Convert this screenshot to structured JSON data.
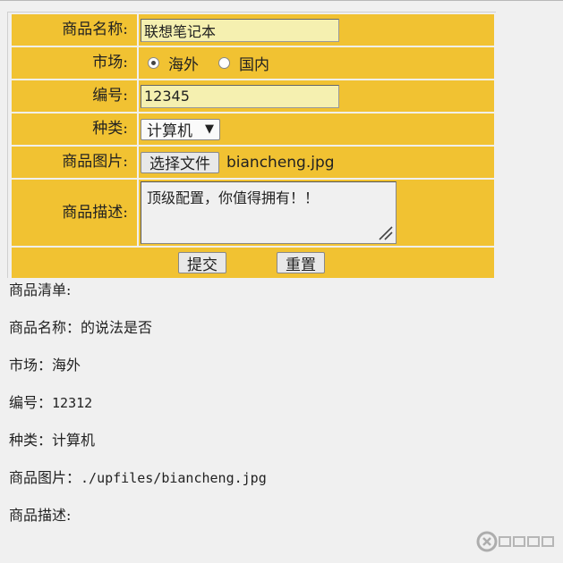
{
  "form": {
    "name_label": "商品名称:",
    "name_value": "联想笔记本",
    "market_label": "市场:",
    "market_options": [
      "海外",
      "国内"
    ],
    "market_selected": "海外",
    "code_label": "编号:",
    "code_value": "12345",
    "type_label": "种类:",
    "type_selected": "计算机",
    "image_label": "商品图片:",
    "choose_file_label": "选择文件",
    "file_name": "biancheng.jpg",
    "desc_label": "商品描述:",
    "desc_value": "顶级配置，你值得拥有！！",
    "submit_label": "提交",
    "reset_label": "重置",
    "cell_color": "#f1c232",
    "input_bg": "#f5f0b0"
  },
  "result": {
    "title": "商品清单:",
    "name_line": "商品名称：的说法是否",
    "market_line": "市场：海外",
    "code_prefix": "编号：",
    "code_value": "12312",
    "type_line": "种类：计算机",
    "image_prefix": "商品图片：",
    "image_path": "./upfiles/biancheng.jpg",
    "desc_line": "商品描述:"
  },
  "watermark": {
    "icon": "logo-icon"
  }
}
